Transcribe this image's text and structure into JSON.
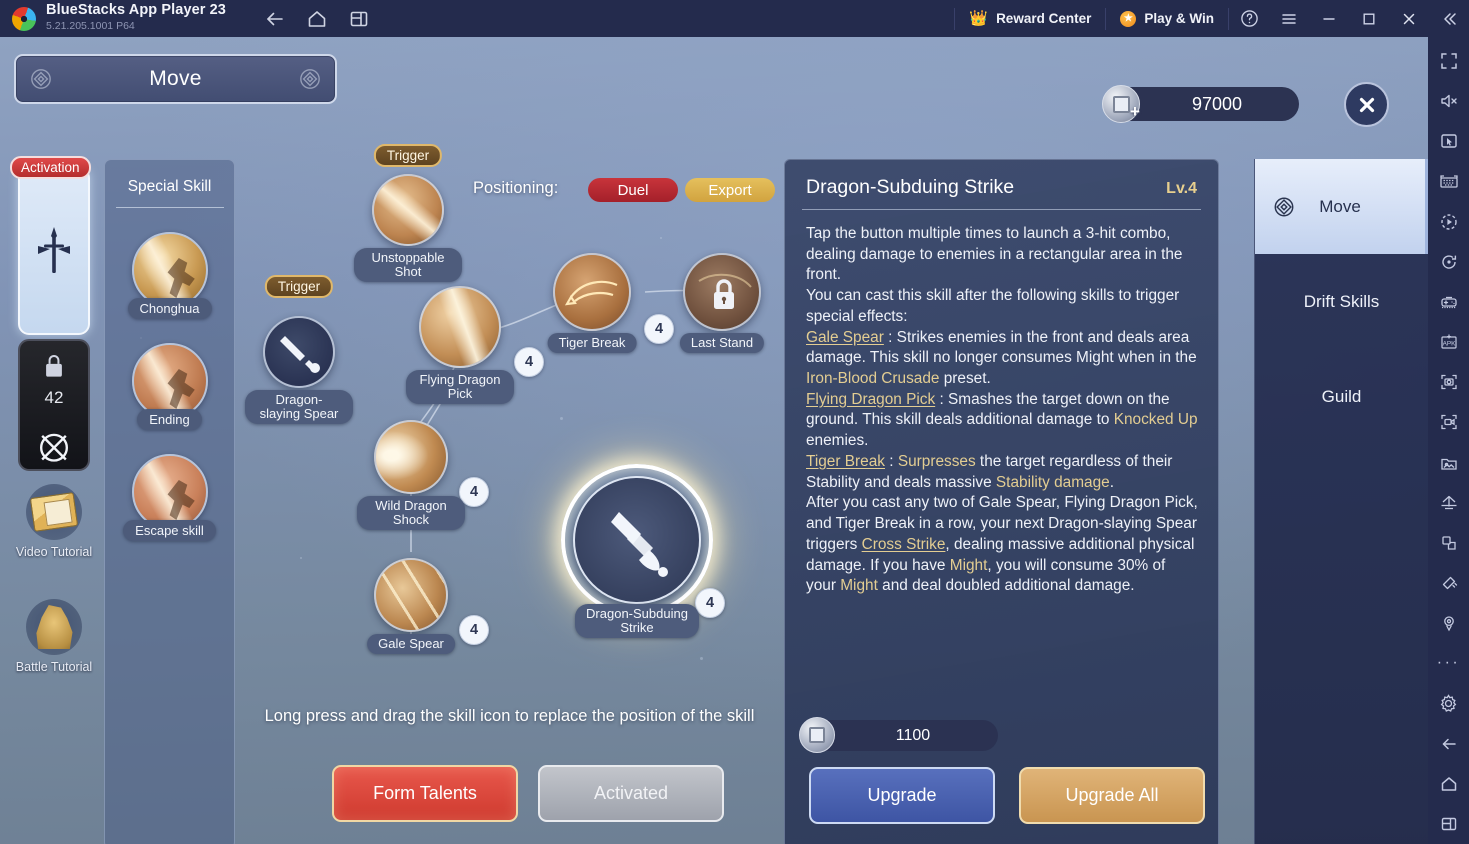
{
  "titlebar": {
    "app_title": "BlueStacks App Player 23",
    "version": "5.21.205.1001  P64",
    "nav": [
      {
        "name": "back-icon",
        "label": "Back"
      },
      {
        "name": "home-icon",
        "label": "Home"
      },
      {
        "name": "multi-instance-icon",
        "label": "Multi-instance"
      }
    ],
    "reward_center": "Reward Center",
    "play_and_win": "Play & Win",
    "help": "?",
    "menu": "☰",
    "minimize": "—",
    "maximize": "□",
    "close": "✕",
    "collapse": "«"
  },
  "game": {
    "top_bar_title": "Move",
    "currency": {
      "value": "97000",
      "plus": "+"
    },
    "close_label": "✕",
    "left_rail": {
      "activation_badge": "Activation",
      "locked_slot_level": "42",
      "items": [
        {
          "name": "video-tutorial",
          "label": "Video Tutorial"
        },
        {
          "name": "battle-tutorial",
          "label": "Battle Tutorial"
        }
      ]
    },
    "special_panel": {
      "title": "Special Skill",
      "skills": [
        {
          "label": "Chonghua",
          "tone": "gold"
        },
        {
          "label": "Ending",
          "tone": "copper"
        },
        {
          "label": "Escape skill",
          "tone": "bronze"
        }
      ]
    },
    "tree": {
      "positioning_label": "Positioning:",
      "tag_duel": "Duel",
      "tag_export": "Export",
      "trigger_tag": "Trigger",
      "nodes": [
        {
          "id": "unstoppable-shot",
          "label": "Unstoppable Shot",
          "level": "",
          "locked": false,
          "trigger": true
        },
        {
          "id": "dragon-slaying-spear",
          "label": "Dragon-slaying Spear",
          "level": "",
          "locked": false,
          "trigger": true
        },
        {
          "id": "flying-dragon-pick",
          "label": "Flying Dragon Pick",
          "level": "4",
          "locked": false,
          "trigger": false
        },
        {
          "id": "tiger-break",
          "label": "Tiger Break",
          "level": "4",
          "locked": false,
          "trigger": false
        },
        {
          "id": "last-stand",
          "label": "Last Stand",
          "level": "",
          "locked": true,
          "trigger": false
        },
        {
          "id": "wild-dragon-shock",
          "label": "Wild Dragon Shock",
          "level": "4",
          "locked": false,
          "trigger": false
        },
        {
          "id": "gale-spear",
          "label": "Gale Spear",
          "level": "4",
          "locked": false,
          "trigger": false
        },
        {
          "id": "dragon-subduing-strike",
          "label": "Dragon-Subduing Strike",
          "level": "4",
          "locked": false,
          "trigger": false
        }
      ]
    },
    "drag_hint": "Long press and drag the skill icon to replace the position of the skill",
    "form_talents_button": "Form Talents",
    "activated_button": "Activated"
  },
  "detail": {
    "skill_name": "Dragon-Subduing Strike",
    "level": "Lv.4",
    "paragraphs": [
      {
        "id": "p1",
        "text": "Tap the button multiple times to launch a 3-hit combo, dealing damage to enemies in a rectangular area in the front."
      },
      {
        "id": "p2",
        "text": "You can cast this skill after the following skills to trigger special effects:"
      }
    ],
    "effects": {
      "gale_spear_name": "Gale Spear",
      "gale_spear_a": " : Strikes enemies in the front and deals area damage. This skill no longer consumes Might when in the ",
      "iron_blood": "Iron-Blood Crusade",
      "gale_spear_b": " preset.",
      "flying_pick_name": "Flying Dragon Pick",
      "flying_pick_a": " : Smashes the target down on the ground. This skill deals additional damage to ",
      "knocked_up": "Knocked Up",
      "flying_pick_b": " enemies.",
      "tiger_break_name": "Tiger Break",
      "tiger_break_a": " : ",
      "surpresses": "Surpresses",
      "tiger_break_b": " the target regardless of their Stability and deals massive ",
      "stability_damage": "Stability damage",
      "tiger_break_c": ".",
      "final_a": "After you cast any two of Gale Spear, Flying Dragon Pick, and Tiger Break in a row, your next Dragon-slaying Spear triggers ",
      "cross_strike": "Cross Strike",
      "final_b": ", dealing massive additional physical damage. If you have ",
      "might_1": "Might",
      "final_c": ", you will consume 30% of your ",
      "might_2": "Might",
      "final_d": " and deal doubled additional damage."
    },
    "cost": "1100",
    "upgrade_button": "Upgrade",
    "upgrade_all_button": "Upgrade All"
  },
  "right_menu": {
    "tabs": [
      {
        "label": "Move",
        "active": true,
        "icon": "diamond-icon"
      },
      {
        "label": "Drift Skills",
        "active": false,
        "icon": ""
      },
      {
        "label": "Guild",
        "active": false,
        "icon": ""
      }
    ]
  },
  "bs_toolbar": {
    "icons": [
      "fullscreen-icon",
      "mute-icon",
      "pointer-icon",
      "keyboard-icon",
      "macro-play-icon",
      "rotate-icon",
      "gamepad-icon",
      "apk-install-icon",
      "screenshot-icon",
      "record-icon",
      "media-manager-icon",
      "eco-mode-icon",
      "multi-instance-sync-icon",
      "shake-icon",
      "location-icon",
      "more-icon",
      "settings-icon",
      "back-icon",
      "home-icon",
      "recents-icon"
    ]
  },
  "colors": {
    "accent_red": "#cf3a2f",
    "accent_gold": "#e0b478",
    "accent_blue": "#3e55a4",
    "panel_dark": "#2c3858",
    "keyword_gold": "#e3cd92"
  }
}
